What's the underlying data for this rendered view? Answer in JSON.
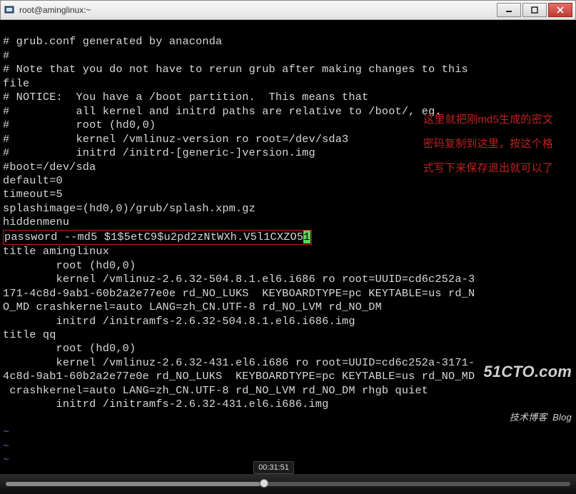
{
  "titlebar": {
    "title": "root@aminglinux:~"
  },
  "terminal": {
    "l1": "# grub.conf generated by anaconda",
    "l2": "#",
    "l3": "# Note that you do not have to rerun grub after making changes to this",
    "l4": "file",
    "l5": "# NOTICE:  You have a /boot partition.  This means that",
    "l6": "#          all kernel and initrd paths are relative to /boot/, eg.",
    "l7": "#          root (hd0,0)",
    "l8": "#          kernel /vmlinuz-version ro root=/dev/sda3",
    "l9": "#          initrd /initrd-[generic-]version.img",
    "l10": "#boot=/dev/sda",
    "l11": "default=0",
    "l12": "timeout=5",
    "l13": "splashimage=(hd0,0)/grub/splash.xpm.gz",
    "l14": "hiddenmenu",
    "password_line": "password --md5 $1$5etC9$u2pd2zNtWXh.V5l1CXZO5",
    "password_cursor_char": "1",
    "l16": "title aminglinux",
    "l17": "        root (hd0,0)",
    "l18": "        kernel /vmlinuz-2.6.32-504.8.1.el6.i686 ro root=UUID=cd6c252a-3",
    "l19": "171-4c8d-9ab1-60b2a2e77e0e rd_NO_LUKS  KEYBOARDTYPE=pc KEYTABLE=us rd_N",
    "l20": "O_MD crashkernel=auto LANG=zh_CN.UTF-8 rd_NO_LVM rd_NO_DM",
    "l21": "        initrd /initramfs-2.6.32-504.8.1.el6.i686.img",
    "l22": "title qq",
    "l23": "        root (hd0,0)",
    "l24": "        kernel /vmlinuz-2.6.32-431.el6.i686 ro root=UUID=cd6c252a-3171-",
    "l25": "4c8d-9ab1-60b2a2e77e0e rd_NO_LUKS  KEYBOARDTYPE=pc KEYTABLE=us rd_NO_MD",
    "l26": " crashkernel=auto LANG=zh_CN.UTF-8 rd_NO_LVM rd_NO_DM rhgb quiet",
    "l27": "        initrd /initramfs-2.6.32-431.el6.i686.img",
    "tilde": "~"
  },
  "annotations": {
    "a1": "这里就把刚md5生成的密文",
    "a2": "密码复制到这里，按这个格",
    "a3": "式写下来保存退出就可以了"
  },
  "watermark": {
    "main": "51CTO.com",
    "sub_zh": "技术博客",
    "sub_en": "Blog"
  },
  "playbar": {
    "time": "00:31:51"
  }
}
